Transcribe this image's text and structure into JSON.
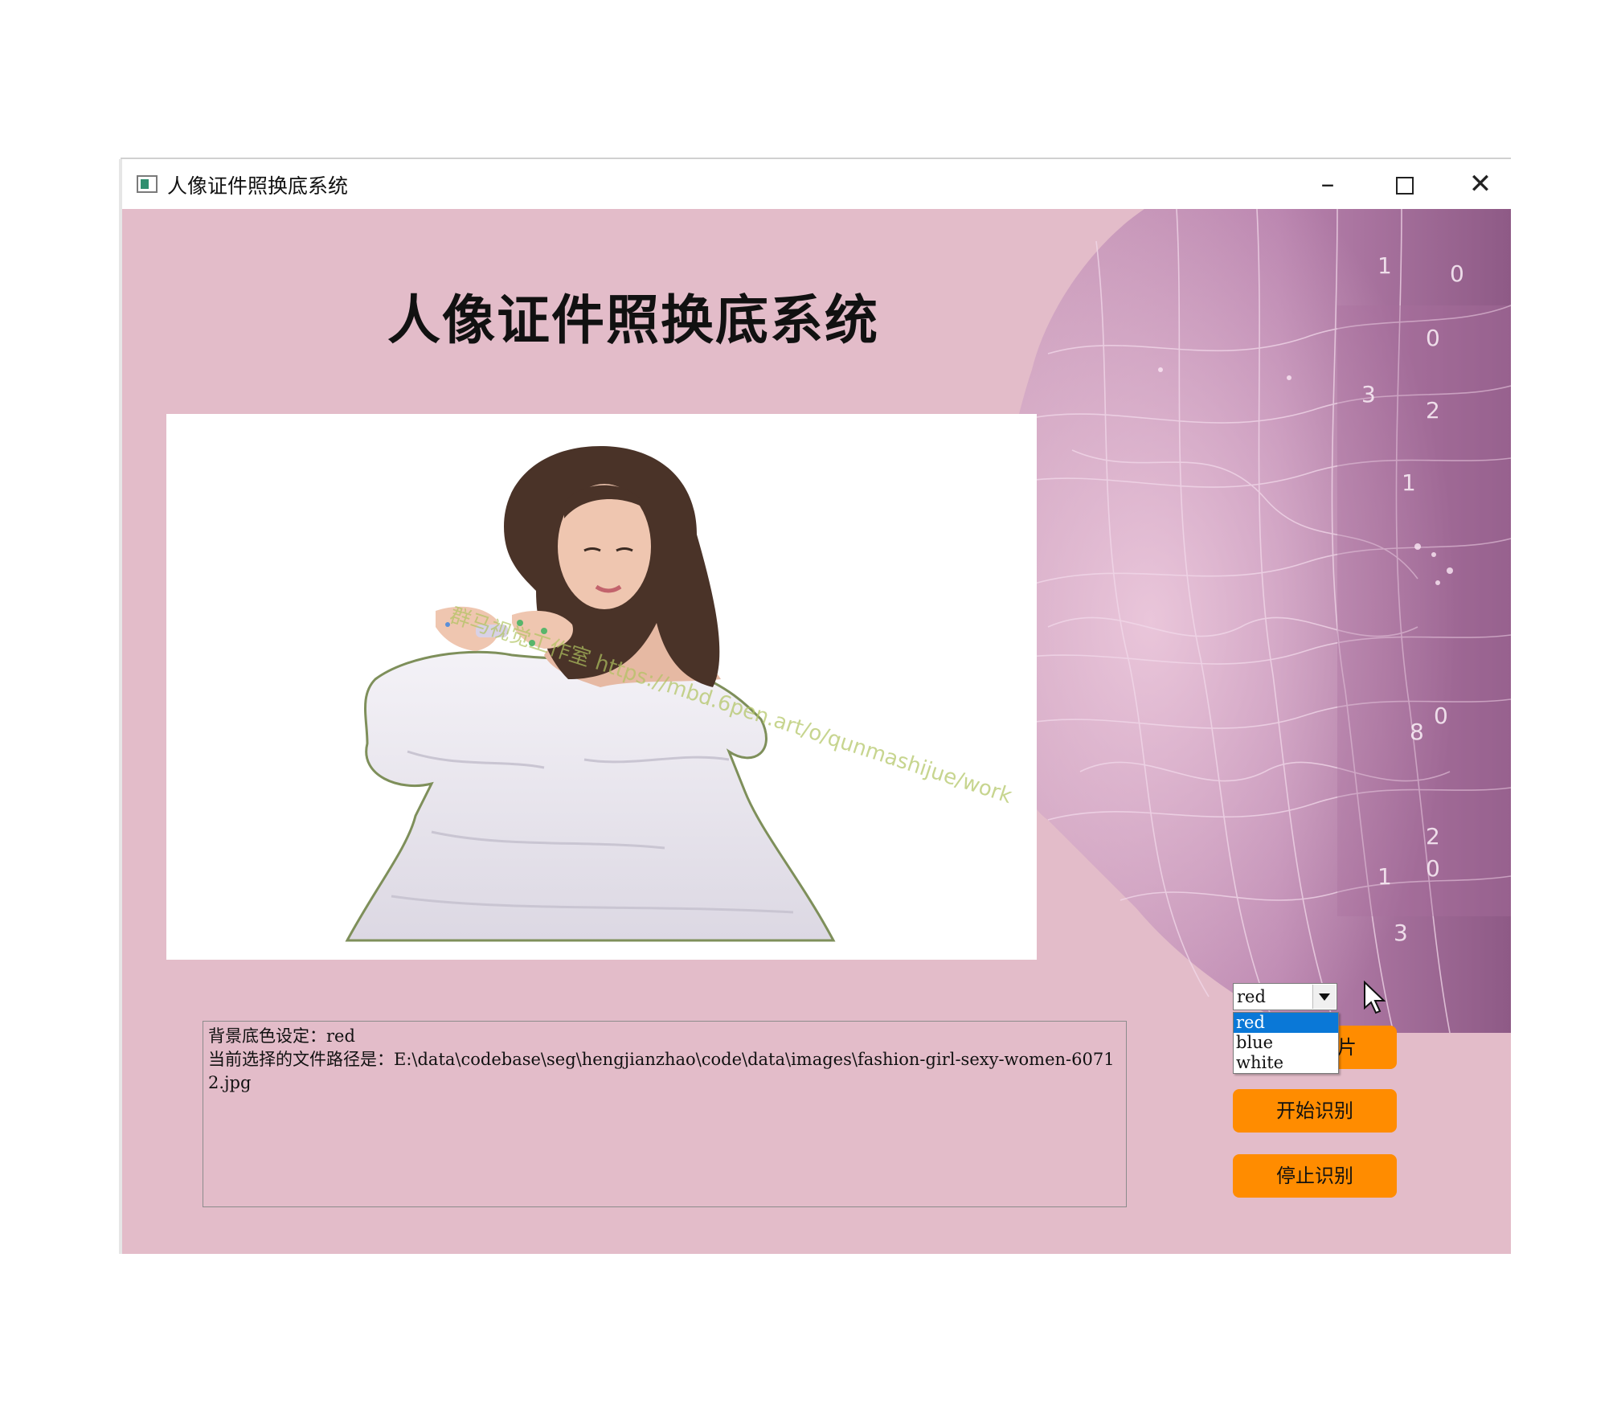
{
  "window": {
    "title": "人像证件照换底系统",
    "controls": {
      "minimize": "–",
      "maximize": "",
      "close": "✕"
    }
  },
  "app": {
    "heading": "人像证件照换底系统"
  },
  "image_panel": {
    "watermark": "群马视觉工作室 https://mbd.6pen.art/o/qunmashijue/work"
  },
  "face_art": {
    "digits": [
      "1",
      "0",
      "0",
      "3",
      "2",
      "1",
      "8",
      "0",
      "2",
      "1",
      "0",
      "3"
    ]
  },
  "log": {
    "text": "背景底色设定：red\n当前选择的文件路径是：E:\\data\\codebase\\seg\\hengjianzhao\\code\\data\\images\\fashion-girl-sexy-women-60712.jpg"
  },
  "color_select": {
    "value": "red",
    "options": [
      "red",
      "blue",
      "white"
    ],
    "selected_index": 0
  },
  "buttons": {
    "b1_visible_fragment": "片",
    "start": "开始识别",
    "stop": "停止识别"
  },
  "colors": {
    "client_bg": "#e3bcc9",
    "button": "#ff8c00",
    "selection": "#0a78d7"
  }
}
